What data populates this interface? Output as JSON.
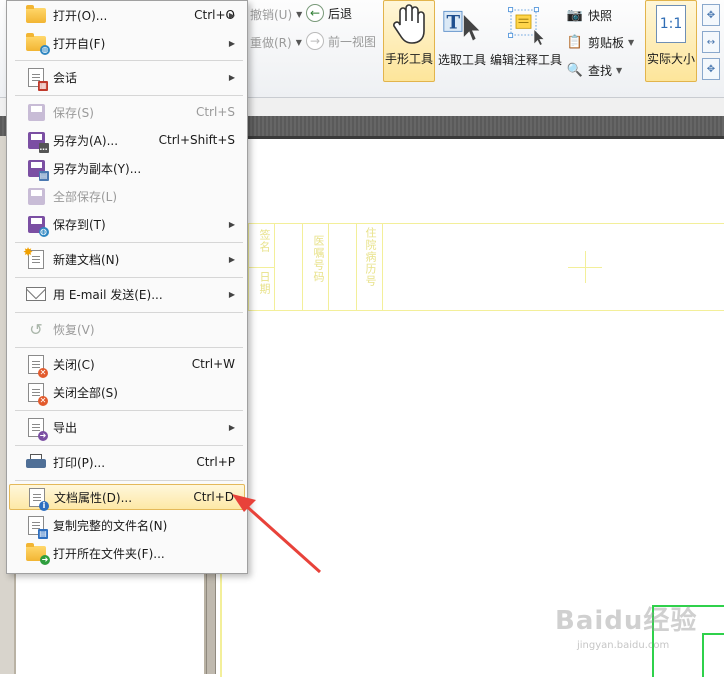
{
  "ribbon": {
    "undo_label": "撤销(U)",
    "redo_label": "重做(R)",
    "back_label": "后退",
    "forward_label": "前一视图",
    "hand_tool_label": "手形工具",
    "select_tool_label": "选取工具",
    "edit_annot_label": "编辑注释工具",
    "snapshot_label": "快照",
    "clipboard_label": "剪贴板",
    "find_label": "查找",
    "actual_size_label": "实际大小",
    "actual_size_icon_text": "1:1"
  },
  "menu": {
    "items": [
      {
        "label": "打开(O)...",
        "shortcut": "Ctrl+O",
        "submenu": true,
        "enabled": true,
        "icon": "folder-open-icon"
      },
      {
        "label": "打开自(F)",
        "shortcut": "",
        "submenu": true,
        "enabled": true,
        "icon": "folder-web-icon"
      },
      {
        "label": "会话",
        "shortcut": "",
        "submenu": true,
        "enabled": true,
        "icon": "session-icon"
      },
      {
        "label": "保存(S)",
        "shortcut": "Ctrl+S",
        "submenu": false,
        "enabled": false,
        "icon": "save-icon"
      },
      {
        "label": "另存为(A)...",
        "shortcut": "Ctrl+Shift+S",
        "submenu": false,
        "enabled": true,
        "icon": "save-as-icon"
      },
      {
        "label": "另存为副本(Y)...",
        "shortcut": "",
        "submenu": false,
        "enabled": true,
        "icon": "save-copy-icon"
      },
      {
        "label": "全部保存(L)",
        "shortcut": "",
        "submenu": false,
        "enabled": false,
        "icon": "save-all-icon"
      },
      {
        "label": "保存到(T)",
        "shortcut": "",
        "submenu": true,
        "enabled": true,
        "icon": "save-to-icon"
      },
      {
        "label": "新建文档(N)",
        "shortcut": "",
        "submenu": true,
        "enabled": true,
        "icon": "new-document-icon"
      },
      {
        "label": "用 E-mail 发送(E)...",
        "shortcut": "",
        "submenu": true,
        "enabled": true,
        "icon": "email-icon"
      },
      {
        "label": "恢复(V)",
        "shortcut": "",
        "submenu": false,
        "enabled": false,
        "icon": "revert-icon"
      },
      {
        "label": "关闭(C)",
        "shortcut": "Ctrl+W",
        "submenu": false,
        "enabled": true,
        "icon": "close-document-icon"
      },
      {
        "label": "关闭全部(S)",
        "shortcut": "",
        "submenu": false,
        "enabled": true,
        "icon": "close-all-icon"
      },
      {
        "label": "导出",
        "shortcut": "",
        "submenu": true,
        "enabled": true,
        "icon": "export-icon"
      },
      {
        "label": "打印(P)...",
        "shortcut": "Ctrl+P",
        "submenu": false,
        "enabled": true,
        "icon": "printer-icon"
      },
      {
        "label": "文档属性(D)...",
        "shortcut": "Ctrl+D",
        "submenu": false,
        "enabled": true,
        "highlighted": true,
        "icon": "document-properties-icon"
      },
      {
        "label": "复制完整的文件名(N)",
        "shortcut": "",
        "submenu": false,
        "enabled": true,
        "icon": "copy-filename-icon"
      },
      {
        "label": "打开所在文件夹(F)...",
        "shortcut": "",
        "submenu": false,
        "enabled": true,
        "icon": "open-folder-icon"
      }
    ]
  },
  "document": {
    "field_sign": "签名",
    "field_date": "日期",
    "field_fax": "医嘱号码",
    "field_record": "住院病历号"
  },
  "watermark": {
    "brand": "Baidu经验",
    "url": "jingyan.baidu.com"
  },
  "colors": {
    "highlight": "#fde8a6",
    "arrow": "#e8423a",
    "grid": "#f3ef9a",
    "accent_green": "#2fd14b"
  }
}
